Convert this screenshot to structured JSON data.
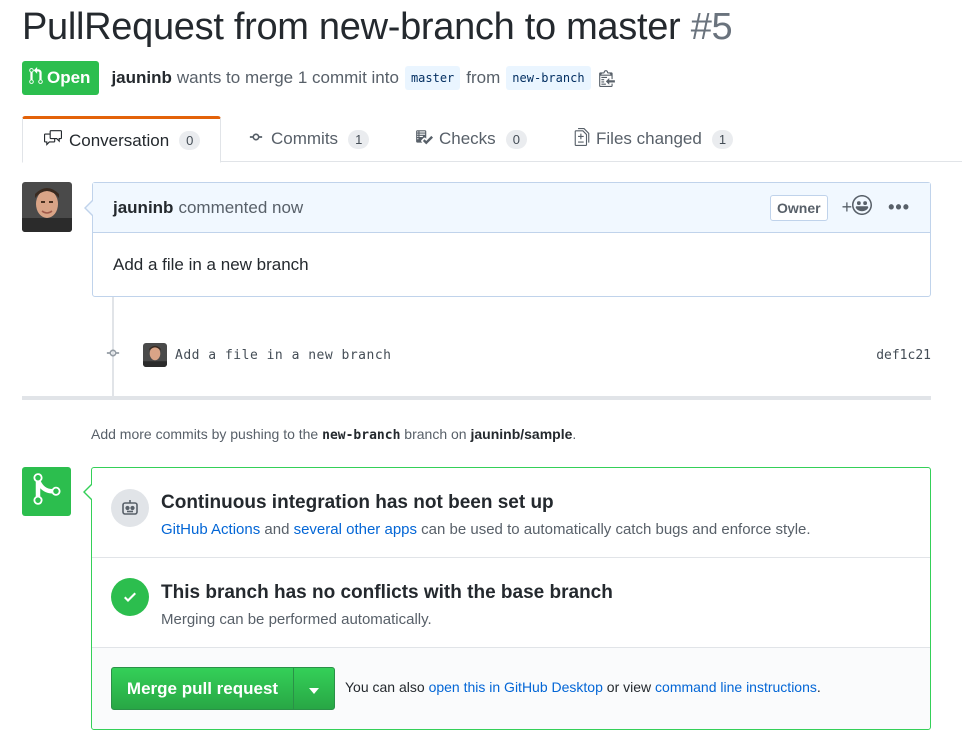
{
  "header": {
    "title": "PullRequest from new-branch to master",
    "number": "#5",
    "state": "Open",
    "author": "jauninb",
    "merge_text": "wants to merge 1 commit into",
    "base_branch": "master",
    "from_text": "from",
    "head_branch": "new-branch"
  },
  "tabs": [
    {
      "label": "Conversation",
      "count": "0"
    },
    {
      "label": "Commits",
      "count": "1"
    },
    {
      "label": "Checks",
      "count": "0"
    },
    {
      "label": "Files changed",
      "count": "1"
    }
  ],
  "comment": {
    "author": "jauninb",
    "action": "commented now",
    "owner_label": "Owner",
    "reaction_plus": "+",
    "more": "•••",
    "body": "Add a file in a new branch"
  },
  "commit": {
    "message": "Add a file in a new branch",
    "sha": "def1c21"
  },
  "push_hint": {
    "prefix": "Add more commits by pushing to the",
    "branch": "new-branch",
    "middle": "branch on",
    "repo": "jauninb/sample",
    "suffix": "."
  },
  "merge_box": {
    "ci_title": "Continuous integration has not been set up",
    "ci_link1": "GitHub Actions",
    "ci_and": "and",
    "ci_link2": "several other apps",
    "ci_rest": "can be used to automatically catch bugs and enforce style.",
    "conflict_title": "This branch has no conflicts with the base branch",
    "conflict_sub": "Merging can be performed automatically.",
    "merge_button": "Merge pull request",
    "also_text": "You can also",
    "desktop_link": "open this in GitHub Desktop",
    "or_view": "or view",
    "cli_link": "command line instructions",
    "end": "."
  },
  "colors": {
    "open_green": "#2cbe4e",
    "link_blue": "#0366d6",
    "tab_accent": "#e36209"
  }
}
